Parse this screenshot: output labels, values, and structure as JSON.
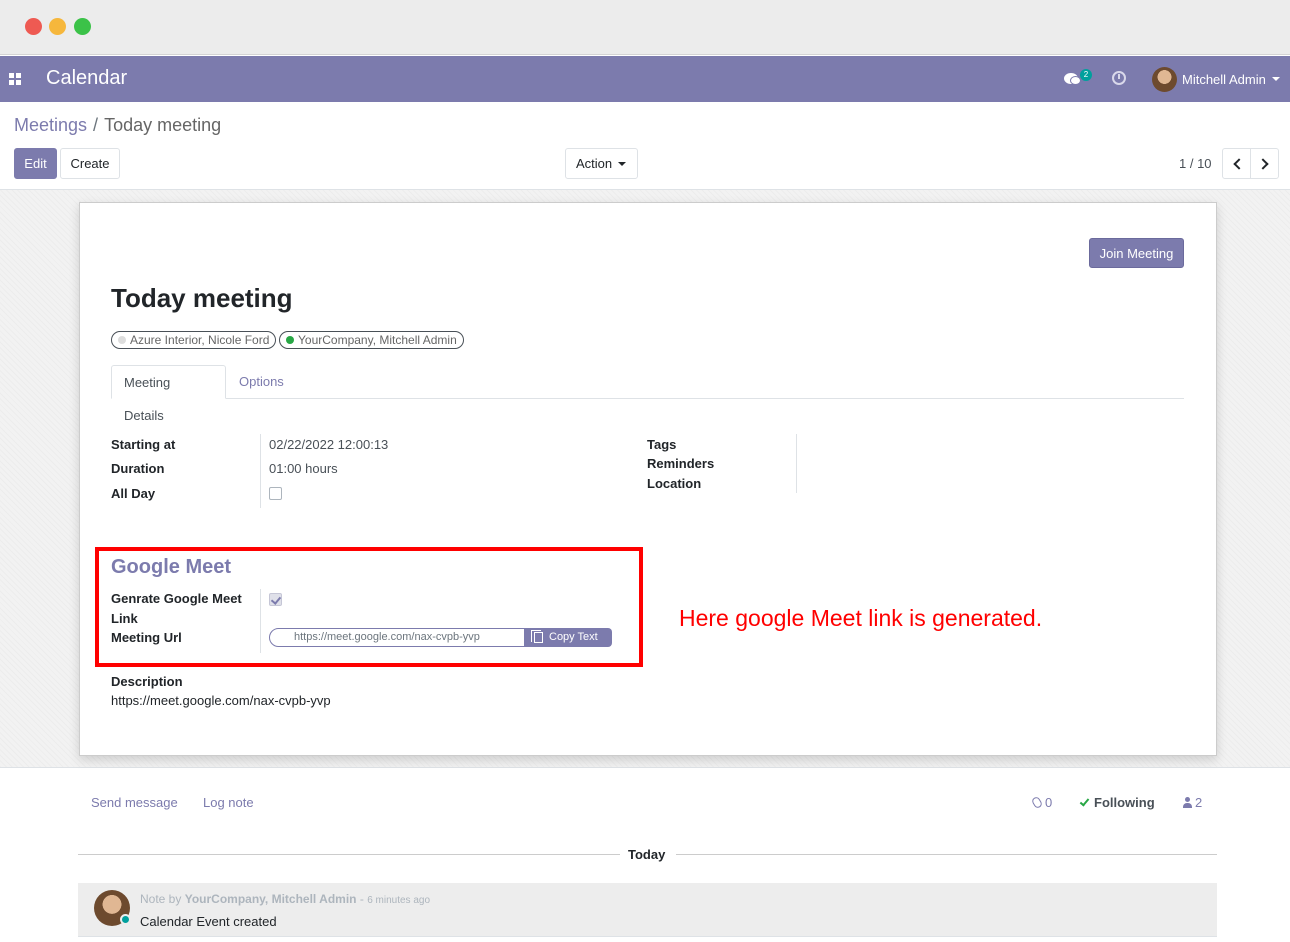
{
  "navbar": {
    "app_title": "Calendar",
    "chat_count": "2",
    "user_name": "Mitchell Admin",
    "color": "#7c7bad"
  },
  "breadcrumb": {
    "parent": "Meetings",
    "separator": "/",
    "current": "Today meeting"
  },
  "control_panel": {
    "edit_label": "Edit",
    "create_label": "Create",
    "action_label": "Action",
    "pager_value": "1 / 10"
  },
  "form": {
    "join_button": "Join Meeting",
    "title": "Today meeting",
    "attendees": [
      {
        "name": "Azure Interior, Nicole Ford",
        "status_color": "#dddddd"
      },
      {
        "name": "YourCompany, Mitchell Admin",
        "status_color": "#28a745"
      }
    ],
    "tabs": [
      {
        "label": "Meeting Details",
        "active": true
      },
      {
        "label": "Options",
        "active": false
      }
    ],
    "left_fields": {
      "starting_at_label": "Starting at",
      "starting_at_value": "02/22/2022 12:00:13",
      "duration_label": "Duration",
      "duration_value": "01:00 hours",
      "all_day_label": "All Day",
      "all_day_checked": false
    },
    "right_fields": {
      "tags_label": "Tags",
      "reminders_label": "Reminders",
      "location_label": "Location"
    },
    "google_meet": {
      "group_title": "Google Meet",
      "generate_label_line1": "Genrate Google Meet",
      "generate_label_line2": "Link",
      "generate_checked": true,
      "meeting_url_label": "Meeting Url",
      "meeting_url_value": "https://meet.google.com/nax-cvpb-yvp",
      "copy_label": "Copy Text"
    },
    "description_label": "Description",
    "description_value": "https://meet.google.com/nax-cvpb-yvp"
  },
  "annotation": {
    "text": "Here google Meet link is generated.",
    "color": "#ff0000"
  },
  "chatter": {
    "send_message": "Send message",
    "log_note": "Log note",
    "attachments_count": "0",
    "following_label": "Following",
    "followers_count": "2",
    "date_separator": "Today",
    "messages": [
      {
        "prefix": "Note by",
        "author": "YourCompany, Mitchell Admin",
        "dash": "-",
        "time": "6 minutes ago",
        "body": "Calendar Event created"
      }
    ]
  }
}
